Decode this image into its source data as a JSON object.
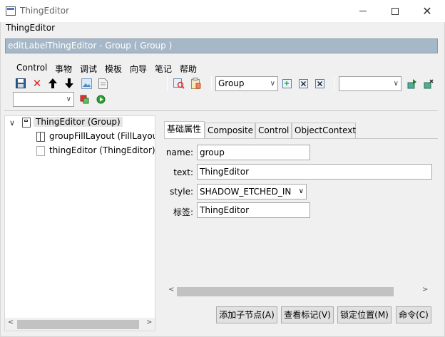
{
  "window": {
    "title": "ThingEditor"
  },
  "thing_label": "ThingEditor",
  "edit_label_bar": "editLabelThingEditor - Group ( Group )",
  "menu": {
    "items": [
      "Control",
      "事物",
      "调试",
      "模板",
      "向导",
      "笔记",
      "帮助"
    ]
  },
  "toolbar": {
    "icons": [
      "save-icon",
      "delete-icon",
      "up-arrow-icon",
      "down-arrow-icon",
      "image-icon",
      "document-icon",
      "search-icon",
      "clipboard-icon",
      "import-icon",
      "close-box-icon",
      "close-box-alt-icon",
      "run-icon",
      "settings-icon",
      "add-icon",
      "play-icon"
    ],
    "type_combo_value": "Group",
    "left_combo_value": "",
    "right_combo_value": ""
  },
  "tree": {
    "nodes": [
      {
        "label": "ThingEditor (Group)",
        "selected": true,
        "expanded": true
      },
      {
        "label": "groupFillLayout (FillLayout)"
      },
      {
        "label": "thingEditor (ThingEditor)"
      }
    ],
    "expand_glyph": "∨"
  },
  "tabs": [
    "基础属性",
    "Composite",
    "Control",
    "ObjectContext"
  ],
  "active_tab": 0,
  "properties": {
    "name_label": "name:",
    "name_value": "group",
    "text_label": "text:",
    "text_value": "ThingEditor",
    "style_label": "style:",
    "style_value": "SHADOW_ETCHED_IN",
    "tag_label": "标签:",
    "tag_value": "ThingEditor"
  },
  "buttons": {
    "add_child": "添加子节点(A)",
    "view_marks": "查看标记(V)",
    "lock_position": "锁定位置(M)",
    "command": "命令(C)"
  },
  "colors": {
    "edit_bar_bg": "#a6b7c7",
    "window_bg": "#f0f0f0"
  }
}
